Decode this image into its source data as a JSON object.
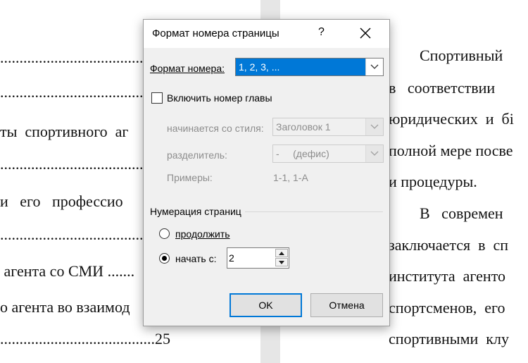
{
  "document": {
    "left_lines": [
      "......................................",
      "......................................",
      "ты  спортивного  аг",
      "......................................",
      "и   его   профессио",
      "......................................",
      " агента со СМИ .......",
      "о агента во взаимод",
      "........................................25"
    ],
    "right_lines": [
      "        Спортивный",
      "в   соответствии   ",
      "юридических  и  бі",
      "полной мере посве",
      "и процедуры.",
      "        В   современ",
      "заключается  в  сп",
      "института  агенто",
      "спортсменов,  его  ",
      "спортивными  клу"
    ]
  },
  "dialog": {
    "title": "Формат номера страницы",
    "help": "?",
    "number_format": {
      "label": "Формат номера:",
      "value": "1, 2, 3, ..."
    },
    "include_chapter": {
      "label": "Включить номер главы",
      "checked": false
    },
    "chapter_style": {
      "label": "начинается со стиля:",
      "value": "Заголовок 1"
    },
    "separator": {
      "label": "разделитель:",
      "value": "-     (дефис)"
    },
    "examples": {
      "label": "Примеры:",
      "value": "1-1, 1-A"
    },
    "page_numbering": {
      "label": "Нумерация страниц",
      "continue_label": "продолжить",
      "start_at_label": "начать с:",
      "start_at_value": "2",
      "selected": "start_at"
    },
    "ok_label": "OK",
    "cancel_label": "Отмена"
  },
  "colors": {
    "accent": "#0078d7",
    "dialog_bg": "#f0f0f0",
    "disabled_text": "#8d8d8d"
  }
}
